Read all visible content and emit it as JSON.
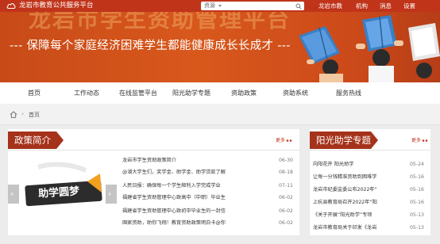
{
  "header": {
    "site_title": "龙岩市教育公共服务平台",
    "search_select": "资源",
    "nav": [
      "龙岩市教",
      "机构",
      "消息",
      "设置"
    ]
  },
  "banner": {
    "ghost_title": "龙岩市学生资助管理平台",
    "slogan": "--- 保障每个家庭经济困难学生都能健康成长长成才 ---"
  },
  "main_nav": [
    "首页",
    "工作动态",
    "在线监管平台",
    "阳光助学专题",
    "资助政策",
    "资助系统",
    "服务热线"
  ],
  "breadcrumb": {
    "current": "首页"
  },
  "policy": {
    "title": "政策简介",
    "more": "更多",
    "slide_caption": "助学圆梦",
    "items": [
      {
        "text": "龙岩市学生资助政策简介",
        "date": "06-30"
      },
      {
        "text": "@湖大学生们，奖学金、助学金、助学贷款了解",
        "date": "08-18"
      },
      {
        "text": "人民日报：确保每一个学生顺利入学完成学业",
        "date": "07-11"
      },
      {
        "text": "福建省学生资助管理中心致高中（中职）毕业生",
        "date": "06-02"
      },
      {
        "text": "福建省学生资助管理中心致初中毕业生的一封信",
        "date": "06-02"
      },
      {
        "text": "国家资助，助你飞翔！教育资助政策明白卡@你",
        "date": "06-02"
      }
    ]
  },
  "sunshine": {
    "title": "阳光助学专题",
    "more": "更多",
    "items": [
      {
        "text": "向阳花开 阳光助学",
        "date": "05-24"
      },
      {
        "text": "让每一分钱精准资助到困难学",
        "date": "05-16"
      },
      {
        "text": "龙岩市纪委监委公布2022年“",
        "date": "05-16"
      },
      {
        "text": "上杭县教育局召开2022年“阳",
        "date": "05-16"
      },
      {
        "text": "《关于开展“阳光助学”专项",
        "date": "05-13"
      },
      {
        "text": "龙岩市教育局关于印发《龙岩",
        "date": "05-13"
      }
    ]
  },
  "colors": {
    "brand": "#c0341a",
    "panel_title": "#a5321a",
    "banner": "#d8581c"
  }
}
